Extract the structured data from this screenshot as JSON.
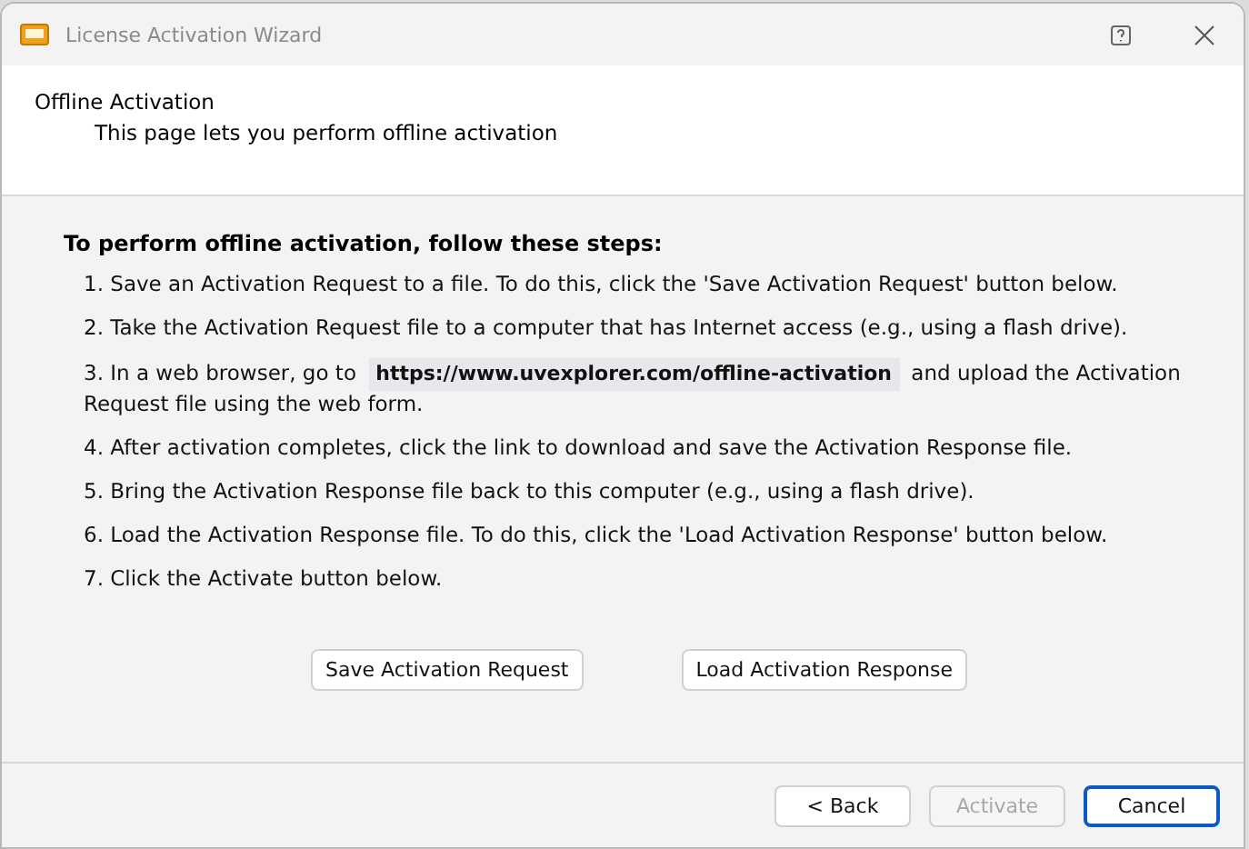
{
  "window": {
    "title": "License Activation Wizard"
  },
  "header": {
    "title": "Offline Activation",
    "subtitle": "This page lets you perform offline activation"
  },
  "intro": "To perform offline activation, follow these steps:",
  "steps": [
    {
      "number": "1.",
      "text": "Save an Activation Request to a file.  To do this, click the 'Save Activation Request' button below."
    },
    {
      "number": "2.",
      "text": "Take the Activation Request file to a computer that has Internet access (e.g., using a flash drive)."
    },
    {
      "number": "3.",
      "text": "In a web browser, go to",
      "link": "https://www.uvexplorer.com/offline-activation",
      "after": "and upload the Activation Request file using the web form."
    },
    {
      "number": "4.",
      "text": "After activation completes, click the link to download and save the Activation Response file."
    },
    {
      "number": "5.",
      "text": "Bring the Activation Response file back to this computer (e.g., using a flash drive)."
    },
    {
      "number": "6.",
      "text": "Load the Activation Response file.  To do this, click the 'Load Activation Response' button below."
    },
    {
      "number": "7.",
      "text": "Click the Activate button below."
    }
  ],
  "actions": [
    "Save Activation Request",
    "Load Activation Response"
  ],
  "footer_buttons": [
    {
      "label": "< Back",
      "disabled": false,
      "default": false
    },
    {
      "label": "Activate",
      "disabled": true,
      "default": false
    },
    {
      "label": "Cancel",
      "disabled": false,
      "default": true
    }
  ]
}
